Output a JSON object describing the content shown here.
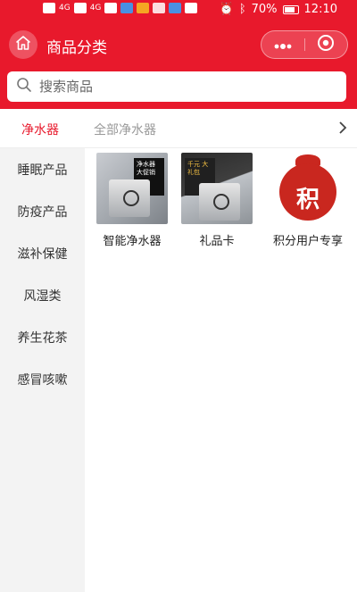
{
  "status_bar": {
    "left_icons": [
      "hd-icon",
      "signal-icon",
      "signal-icon",
      "wifi-icon",
      "app-icon",
      "app-icon",
      "app-icon",
      "app-icon",
      "chat-icon"
    ],
    "network_labels": [
      "4G",
      "4G"
    ],
    "battery": "70%",
    "time": "12:10"
  },
  "header": {
    "title": "商品分类"
  },
  "search": {
    "placeholder": "搜索商品"
  },
  "tabs": {
    "active": "净水器",
    "all": "全部净水器"
  },
  "sidebar": {
    "items": [
      {
        "label": "睡眠产品"
      },
      {
        "label": "防疫产品"
      },
      {
        "label": "滋补保健"
      },
      {
        "label": "风湿类"
      },
      {
        "label": "养生花茶"
      },
      {
        "label": "感冒咳嗽"
      }
    ]
  },
  "products": [
    {
      "name": "智能净水器",
      "image_text": "净水器 大促销"
    },
    {
      "name": "礼品卡",
      "image_text": "千元 大礼包"
    },
    {
      "name": "积分用户专享",
      "image_text": "积"
    }
  ],
  "colors": {
    "brand": "#e8192c",
    "active_tab": "#e8192c",
    "sidebar_bg": "#f3f3f3"
  }
}
